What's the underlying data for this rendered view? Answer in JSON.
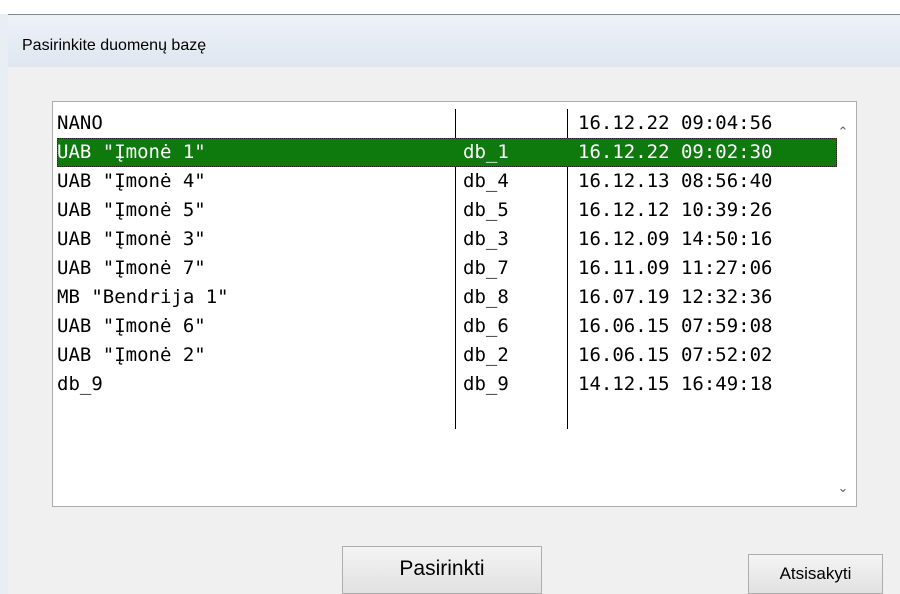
{
  "window": {
    "title": "Pasirinkite duomenų bazę"
  },
  "list": {
    "rows": [
      {
        "name": "NANO",
        "db": "",
        "time": "16.12.22 09:04:56",
        "selected": false
      },
      {
        "name": "UAB \"Įmonė 1\"",
        "db": "db_1",
        "time": "16.12.22 09:02:30",
        "selected": true
      },
      {
        "name": "UAB \"Įmonė 4\"",
        "db": "db_4",
        "time": "16.12.13 08:56:40",
        "selected": false
      },
      {
        "name": "UAB \"Įmonė 5\"",
        "db": "db_5",
        "time": "16.12.12 10:39:26",
        "selected": false
      },
      {
        "name": "UAB \"Įmonė 3\"",
        "db": "db_3",
        "time": "16.12.09 14:50:16",
        "selected": false
      },
      {
        "name": "UAB \"Įmonė 7\"",
        "db": "db_7",
        "time": "16.11.09 11:27:06",
        "selected": false
      },
      {
        "name": "MB \"Bendrija 1\"",
        "db": "db_8",
        "time": "16.07.19 12:32:36",
        "selected": false
      },
      {
        "name": "UAB \"Įmonė 6\"",
        "db": "db_6",
        "time": "16.06.15 07:59:08",
        "selected": false
      },
      {
        "name": "UAB \"Įmonė 2\"",
        "db": "db_2",
        "time": "16.06.15 07:52:02",
        "selected": false
      },
      {
        "name": "db_9",
        "db": "db_9",
        "time": "14.12.15 16:49:18",
        "selected": false
      }
    ],
    "scroll_up_icon": "chevron-up-icon",
    "scroll_down_icon": "chevron-down-icon"
  },
  "buttons": {
    "select_label": "Pasirinkti",
    "cancel_label": "Atsisakyti"
  },
  "colors": {
    "selection": "#0e7a0d",
    "window_bg": "#f0f0f0"
  }
}
